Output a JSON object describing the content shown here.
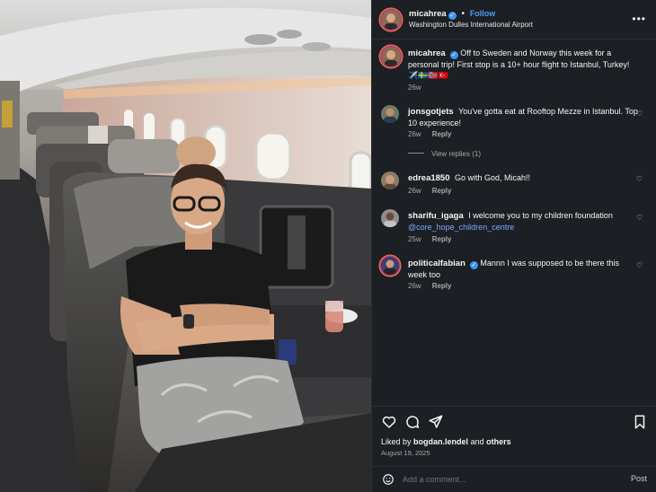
{
  "post": {
    "author": "micahrea",
    "verified_mark": "✓",
    "follow_label": "Follow",
    "separator": "•",
    "location": "Washington Dulles International Airport",
    "more_label": "•••"
  },
  "caption": {
    "username": "micahrea",
    "text": "Off to Sweden and Norway this week for a personal trip! First stop is a 10+ hour flight to Istanbul, Turkey!",
    "emojis": "✈️🇸🇪🇳🇴🇹🇷",
    "time": "26w"
  },
  "comments": [
    {
      "username": "jonsgotjets",
      "verified": false,
      "text": "You've gotta eat at Rooftop Mezze in Istanbul. Top 10 experience!",
      "mention": "",
      "time": "26w",
      "reply_label": "Reply",
      "heart": "♡"
    },
    {
      "username": "edrea1850",
      "verified": false,
      "text": "Go with God, Micah!!",
      "mention": "",
      "time": "26w",
      "reply_label": "Reply",
      "heart": "♡"
    },
    {
      "username": "sharifu_igaga",
      "verified": false,
      "text": "I welcome you to my children foundation",
      "mention": "@core_hope_children_centre",
      "time": "25w",
      "reply_label": "Reply",
      "heart": "♡"
    },
    {
      "username": "politicalfabian",
      "verified": true,
      "text": "Mannn I was supposed to be there this week too",
      "mention": "",
      "time": "26w",
      "reply_label": "Reply",
      "heart": "♡"
    }
  ],
  "view_replies": "View replies (1)",
  "likes": {
    "prefix": "Liked by",
    "user": "bogdan.lendel",
    "and": "and",
    "others": "others"
  },
  "date": "August 19, 2025",
  "add_comment": {
    "placeholder": "Add a comment...",
    "post_label": "Post"
  },
  "icons": {
    "like": "heart-outline-icon",
    "comment": "comment-bubble-icon",
    "share": "paper-plane-icon",
    "save": "bookmark-icon",
    "emoji": "smiley-icon",
    "more": "more-dots-icon"
  },
  "colors": {
    "panel_bg": "#1c1f24",
    "link_blue": "#4c9cf5",
    "verified_blue": "#3897f0",
    "muted": "#a8a8a8"
  }
}
